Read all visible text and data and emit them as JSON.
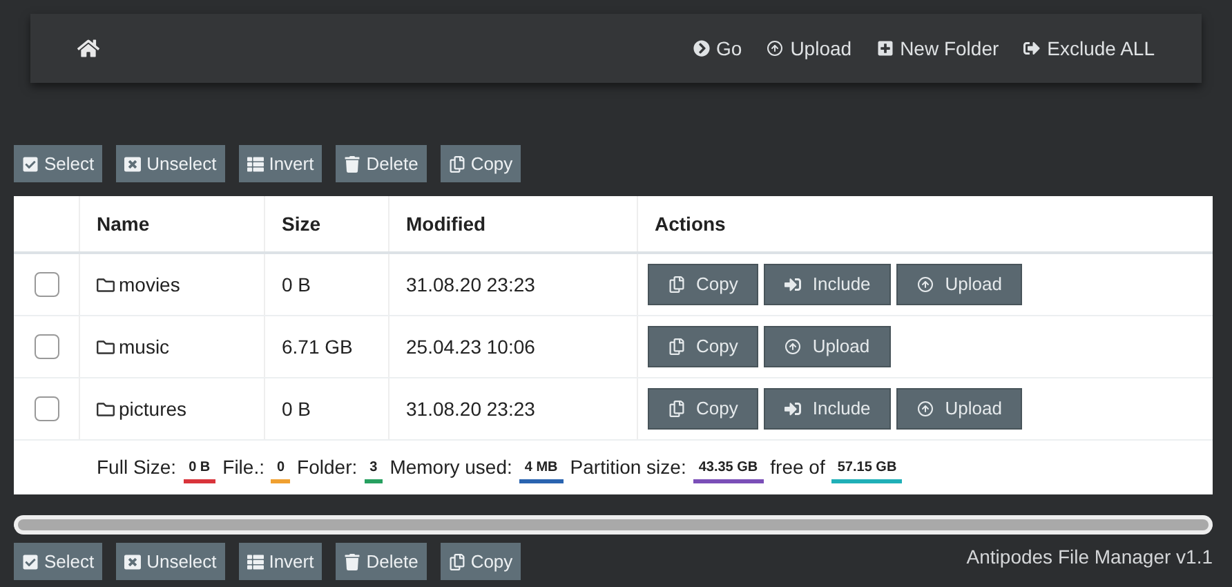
{
  "nav": {
    "links": [
      {
        "kind": "go",
        "label": "Go"
      },
      {
        "kind": "upload",
        "label": "Upload"
      },
      {
        "kind": "new-folder",
        "label": "New Folder"
      },
      {
        "kind": "exclude",
        "label": "Exclude ALL"
      }
    ]
  },
  "toolbar_top": [
    {
      "kind": "select",
      "label": "Select"
    },
    {
      "kind": "unselect",
      "label": "Unselect"
    },
    {
      "kind": "invert",
      "label": "Invert"
    },
    {
      "kind": "delete",
      "label": "Delete"
    },
    {
      "kind": "copy",
      "label": "Copy"
    }
  ],
  "table": {
    "columns": [
      "Name",
      "Size",
      "Modified",
      "Actions"
    ],
    "rows": [
      {
        "checked": false,
        "name": "movies",
        "size": "0 B",
        "modified": "31.08.20 23:23",
        "actions": [
          {
            "kind": "copy",
            "label": "Copy"
          },
          {
            "kind": "include",
            "label": "Include"
          },
          {
            "kind": "upload",
            "label": "Upload"
          }
        ]
      },
      {
        "checked": false,
        "name": "music",
        "size": "6.71 GB",
        "modified": "25.04.23 10:06",
        "actions": [
          {
            "kind": "copy",
            "label": "Copy"
          },
          {
            "kind": "upload",
            "label": "Upload"
          }
        ]
      },
      {
        "checked": false,
        "name": "pictures",
        "size": "0 B",
        "modified": "31.08.20 23:23",
        "actions": [
          {
            "kind": "copy",
            "label": "Copy"
          },
          {
            "kind": "include",
            "label": "Include"
          },
          {
            "kind": "upload",
            "label": "Upload"
          }
        ]
      }
    ],
    "summary": [
      {
        "label": "Full Size:",
        "value": "0 B",
        "color": "#d9343b"
      },
      {
        "label": "File.:",
        "value": "0",
        "color": "#f0a030"
      },
      {
        "label": "Folder:",
        "value": "3",
        "color": "#27a060"
      },
      {
        "label": "Memory used:",
        "value": "4 MB",
        "color": "#2a64b0"
      },
      {
        "label": "Partition size:",
        "value": "43.35 GB",
        "color": "#7b4fb8"
      },
      {
        "label": "free of",
        "value": "57.15 GB",
        "color": "#20b0b8"
      }
    ]
  },
  "toolbar_bottom": [
    {
      "kind": "select",
      "label": "Select"
    },
    {
      "kind": "unselect",
      "label": "Unselect"
    },
    {
      "kind": "invert",
      "label": "Invert"
    },
    {
      "kind": "delete",
      "label": "Delete"
    },
    {
      "kind": "copy",
      "label": "Copy"
    }
  ],
  "footer": "Antipodes File Manager v1.1"
}
